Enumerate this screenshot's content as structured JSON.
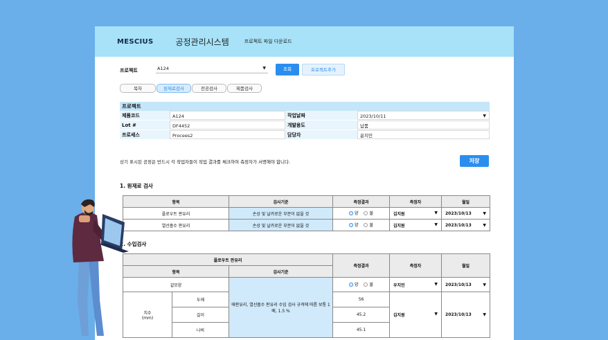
{
  "header": {
    "logo": "MESCIUS",
    "system_title": "공정관리시스템",
    "download_link": "프로젝트 파일 다운로드"
  },
  "project_bar": {
    "label": "프로젝트",
    "selected": "A124",
    "search_button": "조회",
    "add_button": "프로젝트추가"
  },
  "tabs": [
    "목차",
    "원재료검사",
    "전공검사",
    "제품검사"
  ],
  "project_info": {
    "title": "프로젝트",
    "code_label": "제품코드",
    "code_value": "A124",
    "date_label": "작업날짜",
    "date_value": "2023/10/11",
    "lot_label": "Lot #",
    "lot_value": "DF4452",
    "purpose_label": "개발용도",
    "purpose_value": "납품",
    "process_label": "프로세스",
    "process_value": "Procees2",
    "owner_label": "담당자",
    "owner_value": "윤지민"
  },
  "notice": "상기 표시된 공정은 반드시 각 작업자들이 작업 결과를 체크하여 측정자가 서명해야 합니다.",
  "save_button": "저장",
  "section1": {
    "title": "1. 원재료 검사",
    "headers": [
      "항목",
      "검사기준",
      "측정결과",
      "측정자",
      "월일"
    ],
    "rows": [
      {
        "item": "플로우트 판유리",
        "criteria": "손상 및 날카로운 부분이 없을 것",
        "good": "양",
        "bad": "불",
        "inspector": "김지원",
        "date": "2023/10/13"
      },
      {
        "item": "열선흡수 판유리",
        "criteria": "손상 및 날카로운 부분이 없을 것",
        "good": "양",
        "bad": "불",
        "inspector": "김지원",
        "date": "2023/10/13"
      }
    ]
  },
  "section2": {
    "title": "2. 수입검사",
    "group_header": "플로우트 판유리",
    "headers": {
      "item": "항목",
      "criteria": "검사기준",
      "result": "측정결과",
      "inspector": "측정자",
      "date": "월일"
    },
    "appearance": {
      "item": "겉모양",
      "good": "양",
      "bad": "불",
      "inspector": "우지민",
      "date": "2023/10/13"
    },
    "dimension": {
      "item": "치수",
      "unit": "(mm)",
      "criteria": "때판유리, 열선흡수 판유리 수입 검사 규격에 따름 보통 1배, 1.5 %",
      "rows": [
        {
          "name": "두께",
          "value": "56"
        },
        {
          "name": "길이",
          "value": "45.2"
        },
        {
          "name": "나비",
          "value": "45.1"
        }
      ],
      "inspector": "김지원",
      "date": "2023/10/13"
    }
  },
  "colors": {
    "background": "#6aaeea",
    "header": "#a7e2f8",
    "accent": "#2b8eef",
    "criteria_cell": "#d0e9fb"
  }
}
